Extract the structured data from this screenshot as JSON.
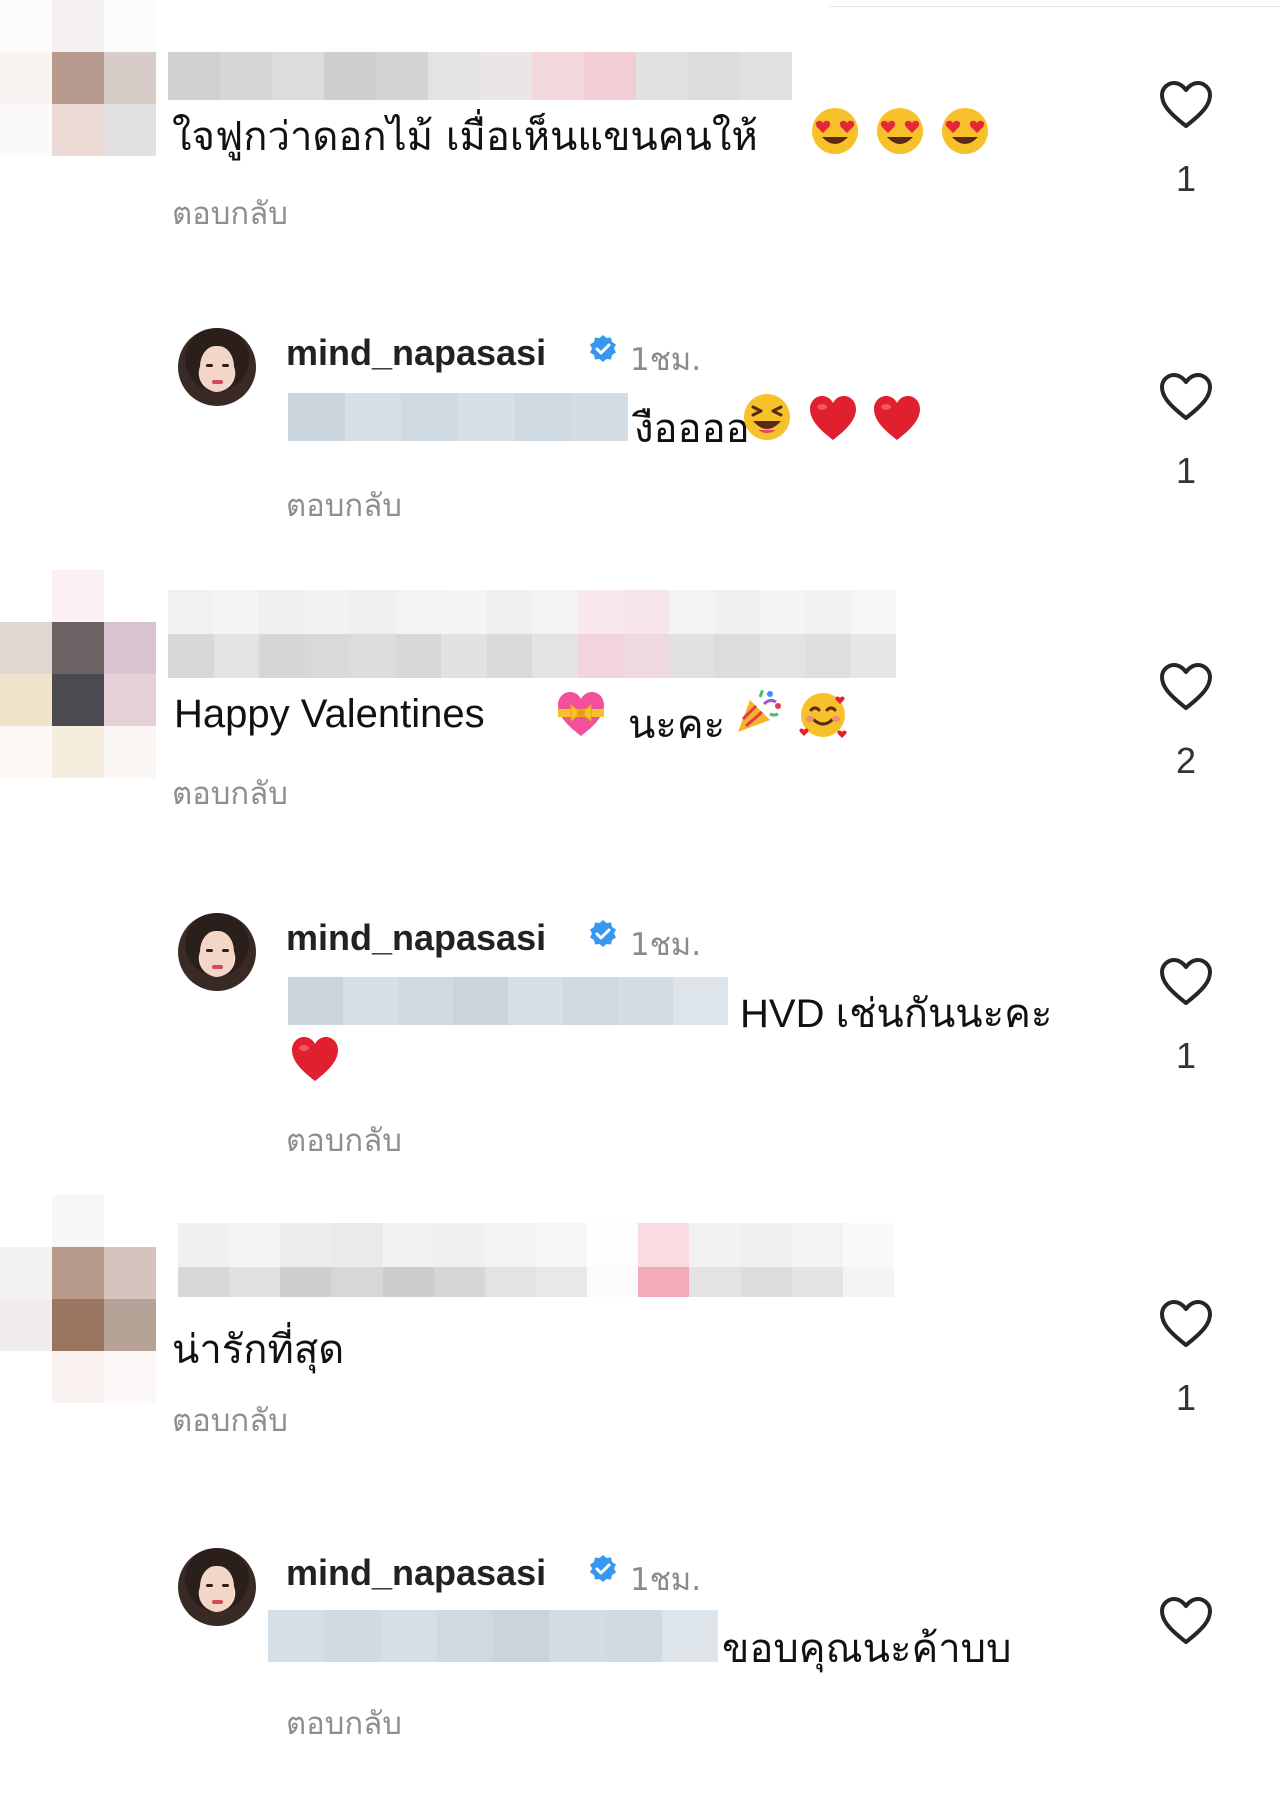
{
  "reply_label": "ตอบกลับ",
  "colors": {
    "verified": "#3897f0",
    "like_heart_stroke": "#262626",
    "reply_text": "#8e8e8e",
    "timestamp_text": "#8a8a8a"
  },
  "comments": [
    {
      "author_visible": false,
      "text": "ใจฟูกว่าดอกไม้ เมื่อเห็นแขนคนให้",
      "emojis": [
        "heart-eyes-emoji",
        "heart-eyes-emoji",
        "heart-eyes-emoji"
      ],
      "likes": "1"
    },
    {
      "author": "mind_napasasi",
      "verified": true,
      "time": "1ชม.",
      "text": "งืออออ",
      "emojis": [
        "laughing-emoji",
        "red-heart-emoji",
        "red-heart-emoji"
      ],
      "likes": "1"
    },
    {
      "author_visible": false,
      "text_en": "Happy Valentines",
      "text_th": "นะคะ",
      "emojis": [
        "heart-ribbon-emoji",
        "party-popper-emoji",
        "smiling-hearts-emoji"
      ],
      "likes": "2"
    },
    {
      "author": "mind_napasasi",
      "verified": true,
      "time": "1ชม.",
      "text": "HVD เช่นกันนะคะ",
      "emojis": [
        "red-heart-emoji"
      ],
      "likes": "1"
    },
    {
      "author_visible": false,
      "text": "น่ารักที่สุด",
      "emojis": [],
      "likes": "1"
    },
    {
      "author": "mind_napasasi",
      "verified": true,
      "time": "1ชม.",
      "text": "ขอบคุณนะค้าบบ",
      "emojis": [],
      "likes": ""
    }
  ]
}
